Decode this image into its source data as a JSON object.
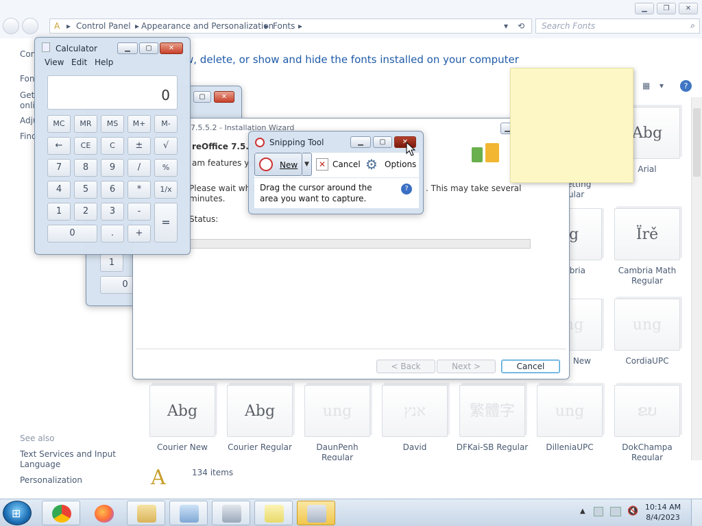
{
  "explorer": {
    "breadcrumb": [
      "Control Panel",
      "Appearance and Personalization",
      "Fonts"
    ],
    "search_placeholder": "Search Fonts",
    "heading": "w, delete, or show and hide the fonts installed on your computer",
    "left_items": [
      "Con",
      "Font",
      "Get",
      "onli",
      "Adju",
      "Find"
    ],
    "see_also": "See also",
    "see_also_links": [
      "Text Services and Input",
      "Language",
      "Personalization"
    ],
    "item_count": "134 items",
    "fonts": [
      {
        "sample": "Abg",
        "name": "Arial"
      },
      {
        "sample": "bg",
        "name": "mbria"
      },
      {
        "sample": "Ïrě",
        "name": "Cambria Math Regular"
      },
      {
        "sample": "ung",
        "name": "a New"
      },
      {
        "sample": "ung",
        "name": "CordiaUPC"
      },
      {
        "sample": "Abg",
        "name": "Courier New"
      },
      {
        "sample": "Abg",
        "name": "Courier Regular"
      },
      {
        "sample": "ung",
        "name": "DaunPenh Regular"
      },
      {
        "sample": "אנץ",
        "name": "David"
      },
      {
        "sample": "繁體字",
        "name": "DFKai-SB Regular"
      },
      {
        "sample": "ung",
        "name": "DilleniaUPC"
      },
      {
        "sample": "ຂບ",
        "name": "DokChampa Regular"
      }
    ],
    "partial_labels": [
      "etting",
      "ular"
    ]
  },
  "calculator": {
    "title": "Calculator",
    "menu": [
      "View",
      "Edit",
      "Help"
    ],
    "display": "0",
    "buttons": [
      "MC",
      "MR",
      "MS",
      "M+",
      "M-",
      "←",
      "CE",
      "C",
      "±",
      "√",
      "7",
      "8",
      "9",
      "/",
      "%",
      "4",
      "5",
      "6",
      "*",
      "1/x",
      "1",
      "2",
      "3",
      "-",
      "=",
      "0",
      ".",
      "+"
    ]
  },
  "calc_behind": {
    "keys": [
      "1",
      "0"
    ]
  },
  "wizard": {
    "title": "7.5.5.2 - Installation Wizard",
    "product": "reOffice 7.5.5.",
    "subtitle": "am features you",
    "message_left": "Please wait while",
    "message_left2": "minutes.",
    "message_right": ". This may take several",
    "status_label": "Status:",
    "back": "< Back",
    "next": "Next >",
    "cancel": "Cancel"
  },
  "snipping": {
    "title": "Snipping Tool",
    "new": "New",
    "cancel": "Cancel",
    "options": "Options",
    "instructions": "Drag the cursor around the area you want to capture."
  },
  "taskbar": {
    "time": "10:14 AM",
    "date": "8/4/2023"
  },
  "colors": {
    "accent": "#1e5aa8",
    "sticky": "#fcf7c5",
    "close": "#c8402a"
  }
}
